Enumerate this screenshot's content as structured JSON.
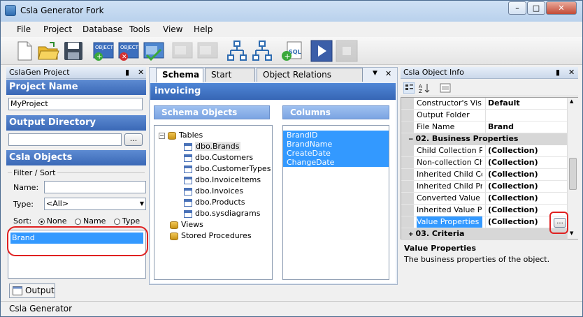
{
  "window": {
    "title": "Csla Generator Fork",
    "minimize": "–",
    "maximize": "□",
    "close": "✕"
  },
  "menu": [
    "File",
    "Project",
    "Database",
    "Tools",
    "View",
    "Help"
  ],
  "toolbar": {
    "new": "new-file-icon",
    "open": "open-folder-icon",
    "save": "save-disk-icon",
    "add_object": "OBJECT",
    "remove_object": "OBJECT",
    "icons": "toolbar-icons"
  },
  "left": {
    "panel_title": "CslaGen Project",
    "pin": "▮",
    "close": "✕",
    "project_name_label": "Project Name",
    "project_name_value": "MyProject",
    "output_dir_label": "Output Directory",
    "output_dir_value": "",
    "browse": "...",
    "csla_objects_label": "Csla Objects",
    "filter_sort": "Filter / Sort",
    "name_label": "Name:",
    "name_value": "",
    "type_label": "Type:",
    "type_value": "<All>",
    "sort_label": "Sort:",
    "sort_none": "None",
    "sort_name": "Name",
    "sort_type": "Type",
    "objects": [
      "Brand"
    ]
  },
  "center": {
    "tabs": [
      "Schema",
      "Start Page",
      "Object Relations Builder"
    ],
    "dropdown": "▼",
    "close": "✕",
    "db_name": "invoicing",
    "schema_objects_label": "Schema Objects",
    "columns_label": "Columns",
    "tree": {
      "tables": "Tables",
      "table_items": [
        "dbo.Brands",
        "dbo.Customers",
        "dbo.CustomerTypes",
        "dbo.InvoiceItems",
        "dbo.Invoices",
        "dbo.Products",
        "dbo.sysdiagrams"
      ],
      "views": "Views",
      "procs": "Stored Procedures",
      "expander": "−"
    },
    "columns": [
      "BrandID",
      "BrandName",
      "CreateDate",
      "ChangeDate"
    ]
  },
  "right": {
    "panel_title": "Csla Object Info",
    "pin": "▮",
    "close": "✕",
    "props_top": [
      {
        "name": "Constructor's Visi",
        "value": "Default"
      },
      {
        "name": "Output Folder",
        "value": ""
      },
      {
        "name": "File Name",
        "value": "Brand"
      }
    ],
    "category_business": "02. Business Properties",
    "props_business": [
      {
        "name": "Child Collection Pr",
        "value": "(Collection)"
      },
      {
        "name": "Non-collection Ch",
        "value": "(Collection)"
      },
      {
        "name": "Inherited Child Co",
        "value": "(Collection)"
      },
      {
        "name": "Inherited Child Pro",
        "value": "(Collection)"
      },
      {
        "name": "Converted Value P",
        "value": "(Collection)"
      },
      {
        "name": "Inherited Value Pr",
        "value": "(Collection)"
      }
    ],
    "selected_prop": {
      "name": "Value Properties",
      "value": "(Collection)"
    },
    "ellipsis": "...",
    "category_criteria": "03. Criteria",
    "help_title": "Value Properties",
    "help_text": "The business properties of the object.",
    "collapse": "−"
  },
  "output_tab": "Output",
  "status": "Csla Generator",
  "colors": {
    "accent": "#3399ff",
    "section": "#3a68b6",
    "highlight_red": "#e02020"
  }
}
